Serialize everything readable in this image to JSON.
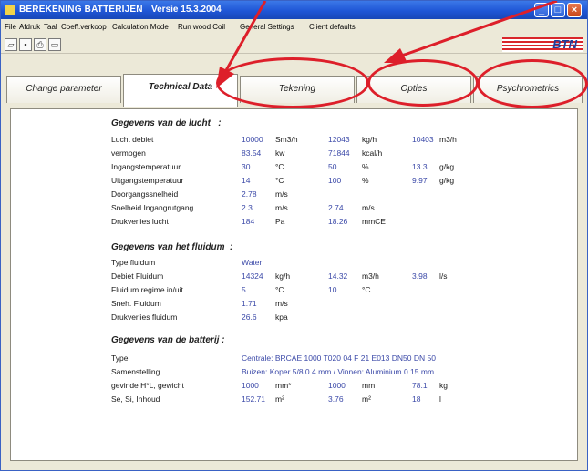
{
  "window": {
    "title": "BEREKENING BATTERIJEN",
    "version": "Versie 15.3.2004"
  },
  "menubar": [
    "File",
    "Afdruk",
    "Taal",
    "Coeff.verkoop",
    "Calculation Mode",
    "Run wood Coil",
    "General Settings",
    "Client defaults"
  ],
  "logo": {
    "text": "BTN"
  },
  "tabs": [
    {
      "label": "Change parameter",
      "active": false
    },
    {
      "label": "Technical Data",
      "active": true
    },
    {
      "label": "Tekening",
      "active": false
    },
    {
      "label": "Opties",
      "active": false
    },
    {
      "label": "Psychrometrics",
      "active": false
    }
  ],
  "air": {
    "title": "Gegevens van de lucht",
    "title_suffix": ":",
    "rows": [
      {
        "label": "Lucht debiet",
        "v1": "10000",
        "u1": "Sm3/h",
        "v2": "12043",
        "u2": "kg/h",
        "v3": "10403",
        "u3": "m3/h"
      },
      {
        "label": "vermogen",
        "v1": "83.54",
        "u1": "kw",
        "v2": "71844",
        "u2": "kcal/h",
        "v3": "",
        "u3": ""
      },
      {
        "label": "Ingangstemperatuur",
        "v1": "30",
        "u1": "°C",
        "v2": "50",
        "u2": "%",
        "v3": "13.3",
        "u3": "g/kg"
      },
      {
        "label": "Uitgangstemperatuur",
        "v1": "14",
        "u1": "°C",
        "v2": "100",
        "u2": "%",
        "v3": "9.97",
        "u3": "g/kg"
      },
      {
        "label": "Doorgangssnelheid",
        "v1": "2.78",
        "u1": "m/s",
        "v2": "",
        "u2": "",
        "v3": "",
        "u3": ""
      },
      {
        "label": "Snelheid Ingangrutgang",
        "v1": "2.3",
        "u1": "m/s",
        "v2": "2.74",
        "u2": "m/s",
        "v3": "",
        "u3": ""
      },
      {
        "label": "Drukverlies lucht",
        "v1": "184",
        "u1": "Pa",
        "v2": "18.26",
        "u2": "mmCE",
        "v3": "",
        "u3": ""
      }
    ]
  },
  "fluid": {
    "title": "Gegevens van het fluidum",
    "title_suffix": ":",
    "rows": [
      {
        "label": "Type fluidum",
        "v1": "Water",
        "u1": "",
        "v2": "",
        "u2": "",
        "v3": "",
        "u3": ""
      },
      {
        "label": "Debiet Fluidum",
        "v1": "14324",
        "u1": "kg/h",
        "v2": "14.32",
        "u2": "m3/h",
        "v3": "3.98",
        "u3": "l/s"
      },
      {
        "label": "Fluidum regime in/uit",
        "v1": "5",
        "u1": "°C",
        "v2": "10",
        "u2": "°C",
        "v3": "",
        "u3": ""
      },
      {
        "label": "Sneh. Fluidum",
        "v1": "1.71",
        "u1": "m/s",
        "v2": "",
        "u2": "",
        "v3": "",
        "u3": ""
      },
      {
        "label": "Drukverlies fluidum",
        "v1": "26.6",
        "u1": "kpa",
        "v2": "",
        "u2": "",
        "v3": "",
        "u3": ""
      }
    ]
  },
  "battery": {
    "title": "Gegevens van de batterij",
    "title_suffix": ":",
    "type_label": "Type",
    "type_value": "Centrale: BRCAE 1000 T020 04 F 21 E013 DN50 DN 50",
    "composition_label": "Samenstelling",
    "composition_value": "Buizen: Koper 5/8 0.4 mm / Vinnen: Aluminium 0.15 mm",
    "rows": [
      {
        "label": "gevinde H*L, gewicht",
        "v1": "1000",
        "u1": "mm*",
        "v2": "1000",
        "u2": "mm",
        "v3": "78.1",
        "u3": "kg"
      },
      {
        "label": "Se, Si, Inhoud",
        "v1": "152.71",
        "u1": "m²",
        "v2": "3.76",
        "u2": "m²",
        "v3": "18",
        "u3": "l"
      }
    ]
  },
  "colors": {
    "annotation": "#dd1f2a",
    "titlebar": "#1f56d6",
    "value": "#3b49a8"
  }
}
